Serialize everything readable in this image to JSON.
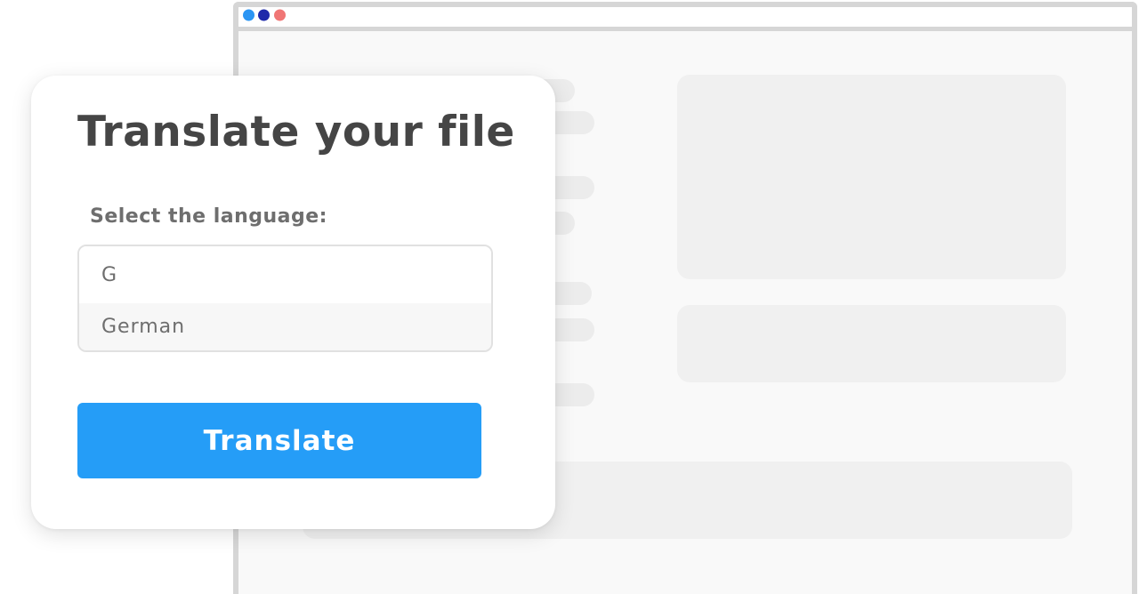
{
  "card": {
    "title": "Translate your file",
    "language_label": "Select the language:",
    "language_input_value": "G",
    "language_suggestions": [
      "German"
    ],
    "translate_button": "Translate"
  },
  "browser": {
    "window_controls": [
      "blue-dot",
      "navy-dot",
      "red-dot"
    ]
  },
  "colors": {
    "accent": "#259df7",
    "text": "#454545",
    "muted_text": "#6e6e6e",
    "dot_blue": "#2b95f3",
    "dot_navy": "#1f2aaa",
    "dot_red": "#f07675"
  }
}
